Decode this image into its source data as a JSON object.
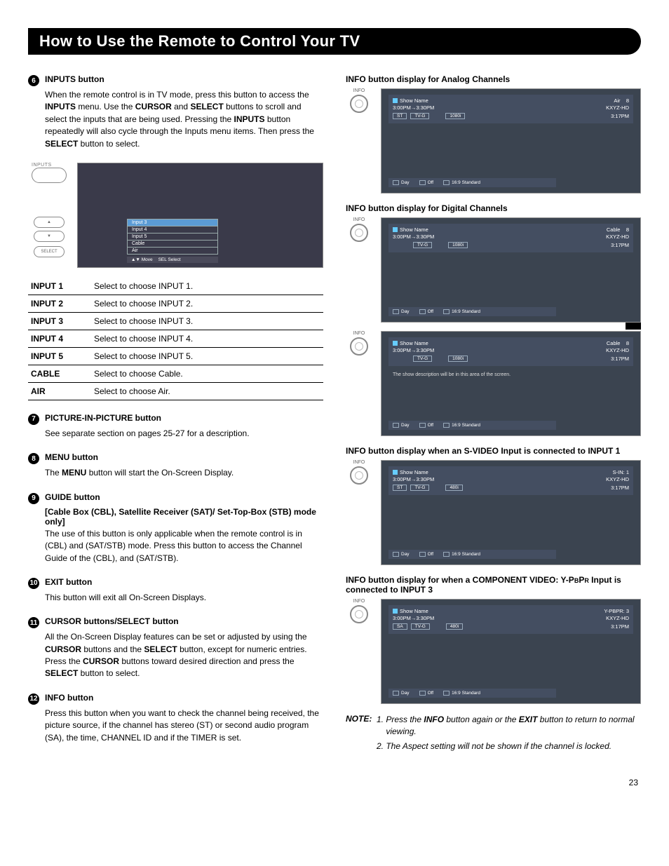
{
  "title": "How to Use the Remote to Control Your TV",
  "page_number": "23",
  "left_items": {
    "i6": {
      "num": "6",
      "title": "INPUTS button",
      "body_pre": "When the remote control is in TV mode, press this button to access the ",
      "b1": "INPUTS",
      "body_mid1": " menu. Use the ",
      "b2": "CURSOR",
      "body_mid2": " and ",
      "b3": "SELECT",
      "body_mid3": " buttons to scroll and select the inputs that are being used. Pressing the ",
      "b4": "INPUTS",
      "body_mid4": " button repeatedly will also cycle through the Inputs menu items. Then press the ",
      "b5": "SELECT",
      "body_end": " button to select."
    },
    "osd": {
      "btn_label": "INPUTS",
      "select_label": "SELECT",
      "rows": [
        "Input 3",
        "Input 4",
        "Input 5",
        "Cable",
        "Air"
      ],
      "foot_move": "Move",
      "foot_sel": "Select",
      "foot_sel_pre": "SEL"
    },
    "table": [
      {
        "k": "INPUT 1",
        "v": "Select to choose INPUT 1."
      },
      {
        "k": "INPUT 2",
        "v": "Select to choose INPUT 2."
      },
      {
        "k": "INPUT 3",
        "v": "Select to choose INPUT 3."
      },
      {
        "k": "INPUT 4",
        "v": "Select to choose INPUT 4."
      },
      {
        "k": "INPUT 5",
        "v": "Select to choose INPUT 5."
      },
      {
        "k": "CABLE",
        "v": "Select to choose Cable."
      },
      {
        "k": "AIR",
        "v": "Select to choose Air."
      }
    ],
    "i7": {
      "num": "7",
      "title": "PICTURE-IN-PICTURE button",
      "body": "See separate section on pages 25-27 for a description."
    },
    "i8": {
      "num": "8",
      "title": "MENU button",
      "body_pre": "The ",
      "b1": "MENU",
      "body_end": " button will start the On-Screen Display."
    },
    "i9": {
      "num": "9",
      "title": "GUIDE button",
      "sub": "[Cable Box (CBL), Satellite Receiver (SAT)/ Set-Top-Box (STB) mode only]",
      "body": "The use of this button is only applicable when the remote control is in (CBL) and (SAT/STB) mode. Press this button to access the Channel Guide of the (CBL), and (SAT/STB)."
    },
    "i10": {
      "num": "10",
      "title": "EXIT button",
      "body": "This button will exit all On-Screen Displays."
    },
    "i11": {
      "num": "11",
      "title": "CURSOR buttons/SELECT button",
      "body_pre": "All the On-Screen Display features can be set or adjusted by using the ",
      "b1": "CURSOR",
      "mid1": " buttons and the ",
      "b2": "SELECT",
      "mid2": " button, except for numeric entries. Press the ",
      "b3": "CURSOR",
      "mid3": " buttons toward desired direction and press the ",
      "b4": "SELECT",
      "end": " button to select."
    },
    "i12": {
      "num": "12",
      "title": "INFO button",
      "body": "Press this button when you want to check the channel being received, the picture source, if the channel has stereo (ST) or second audio program (SA), the time, CHANNEL ID and if the TIMER is set."
    }
  },
  "right": {
    "h1": "INFO button display for Analog Channels",
    "h2": "INFO button display for Digital Channels",
    "h3": "INFO button display when an S-VIDEO Input is connected to INPUT 1",
    "h4_a": "INFO button display for when a COMPONENT VIDEO: Y-P",
    "h4_b": "B",
    "h4_c": "P",
    "h4_d": "R",
    "h4_e": " Input is connected to INPUT 3",
    "info_label": "INFO",
    "common": {
      "show": "Show Name",
      "time_line": "3:00PM→3:30PM",
      "kxyz": "KXYZ-HD",
      "clock": "3:17PM",
      "day": "Day",
      "off": "Off",
      "aspect": "16:9 Standard",
      "ch": "8"
    },
    "d1": {
      "src": "Air",
      "res": "1080i",
      "tag1": "ST",
      "tag2": "TV-G"
    },
    "d2": {
      "src": "Cable",
      "res": "1080i",
      "tag2": "TV-G"
    },
    "d3": {
      "src": "Cable",
      "res": "1080i",
      "tag2": "TV-G",
      "desc": "The show description will be in this area of the screen."
    },
    "d4": {
      "src": "S-IN: 1",
      "res": "480i",
      "tag1": "ST",
      "tag2": "TV-G"
    },
    "d5": {
      "src": "Y-PBPR: 3",
      "res": "480i",
      "tag1": "SA",
      "tag2": "TV-G"
    }
  },
  "note": {
    "label": "NOTE:",
    "n1_a": "Press the ",
    "n1_b": "INFO",
    "n1_c": " button again or the ",
    "n1_d": "EXIT",
    "n1_e": " button to return to normal viewing.",
    "n2": "The Aspect setting will not be shown if the channel is locked."
  }
}
